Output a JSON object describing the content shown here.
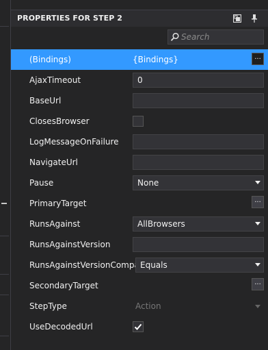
{
  "panel": {
    "title": "PROPERTIES FOR STEP 2"
  },
  "search": {
    "placeholder": "Search"
  },
  "properties": [
    {
      "name": "(Bindings)",
      "value": "{Bindings}",
      "editor": "text-ellipsis",
      "selected": true
    },
    {
      "name": "AjaxTimeout",
      "value": "0",
      "editor": "textbox"
    },
    {
      "name": "BaseUrl",
      "value": "",
      "editor": "textbox"
    },
    {
      "name": "ClosesBrowser",
      "value": "false",
      "editor": "checkbox"
    },
    {
      "name": "LogMessageOnFailure",
      "value": "",
      "editor": "textbox"
    },
    {
      "name": "NavigateUrl",
      "value": "",
      "editor": "textbox"
    },
    {
      "name": "Pause",
      "value": "None",
      "editor": "combo"
    },
    {
      "name": "PrimaryTarget",
      "value": "",
      "editor": "ellipsis"
    },
    {
      "name": "RunsAgainst",
      "value": "AllBrowsers",
      "editor": "combo"
    },
    {
      "name": "RunsAgainstVersion",
      "value": "",
      "editor": "textbox"
    },
    {
      "name": "RunsAgainstVersionCompare",
      "value": "Equals",
      "editor": "combo"
    },
    {
      "name": "SecondaryTarget",
      "value": "",
      "editor": "ellipsis"
    },
    {
      "name": "StepType",
      "value": "Action",
      "editor": "disabled-combo"
    },
    {
      "name": "UseDecodedUrl",
      "value": "true",
      "editor": "checkbox"
    }
  ],
  "ellipsis_label": "...",
  "colors": {
    "selection": "#3399ff",
    "background": "#252526",
    "text": "#f1f1f1"
  }
}
